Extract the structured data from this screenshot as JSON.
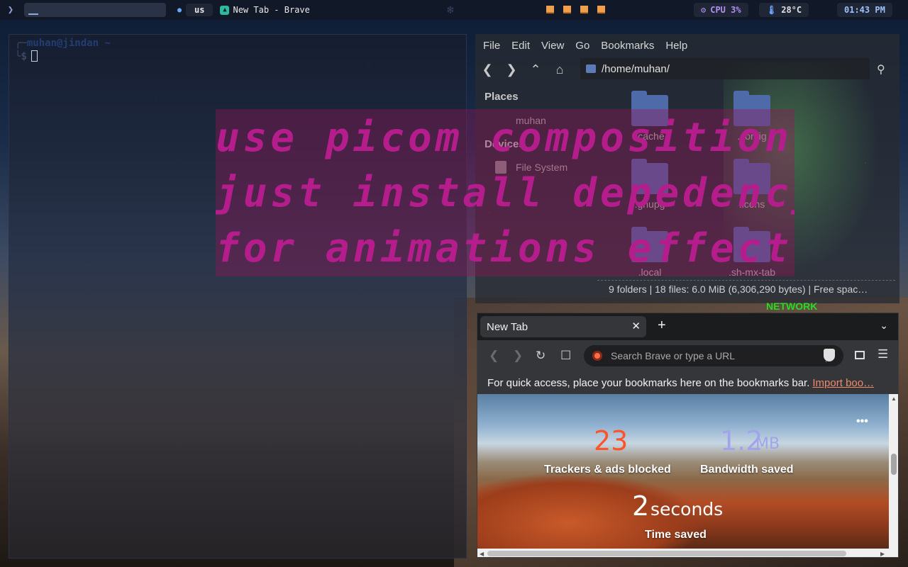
{
  "topbar": {
    "layout": "us",
    "window_title": "New Tab - Brave",
    "cpu": "CPU 3%",
    "temperature": "28°C",
    "clock": "01:43 PM",
    "icons": [
      "arch-launcher-icon",
      "brave-app-icon",
      "cpu-icon",
      "thermometer-icon"
    ]
  },
  "terminal": {
    "prompt_user": "muhan@jindan",
    "prompt_dir": "~",
    "prompt_symbol": "$"
  },
  "file_manager": {
    "menu": [
      "File",
      "Edit",
      "View",
      "Go",
      "Bookmarks",
      "Help"
    ],
    "path": "/home/muhan/",
    "places_heading": "Places",
    "places_item": "muhan",
    "devices_heading": "Devices",
    "devices_item": "File System",
    "files": [
      ".cache",
      ".config",
      ".gnupg",
      ".icons",
      ".local",
      ".sh-mx-tab"
    ],
    "status": "9 folders  |  18 files: 6.0 MiB (6,306,290 bytes)  |  Free spac…"
  },
  "overlay": {
    "line1": "use picom composition",
    "line2": "just install depedency",
    "line3": "for animations effect"
  },
  "conky": {
    "network_label": "NETWORK"
  },
  "browser": {
    "tab_title": "New Tab",
    "url_placeholder": "Search Brave or type a URL",
    "bookmarks_hint": "For quick access, place your bookmarks here on the bookmarks bar.",
    "import_link": "Import boo…",
    "trackers_count": "23",
    "trackers_label": "Trackers & ads blocked",
    "bandwidth_value": "1.2",
    "bandwidth_unit": "MB",
    "bandwidth_label": "Bandwidth saved",
    "time_value": "2",
    "time_unit": "seconds",
    "time_label": "Time saved",
    "colors": {
      "trackers": "#fb542b",
      "bandwidth": "#a0a5eb"
    }
  }
}
